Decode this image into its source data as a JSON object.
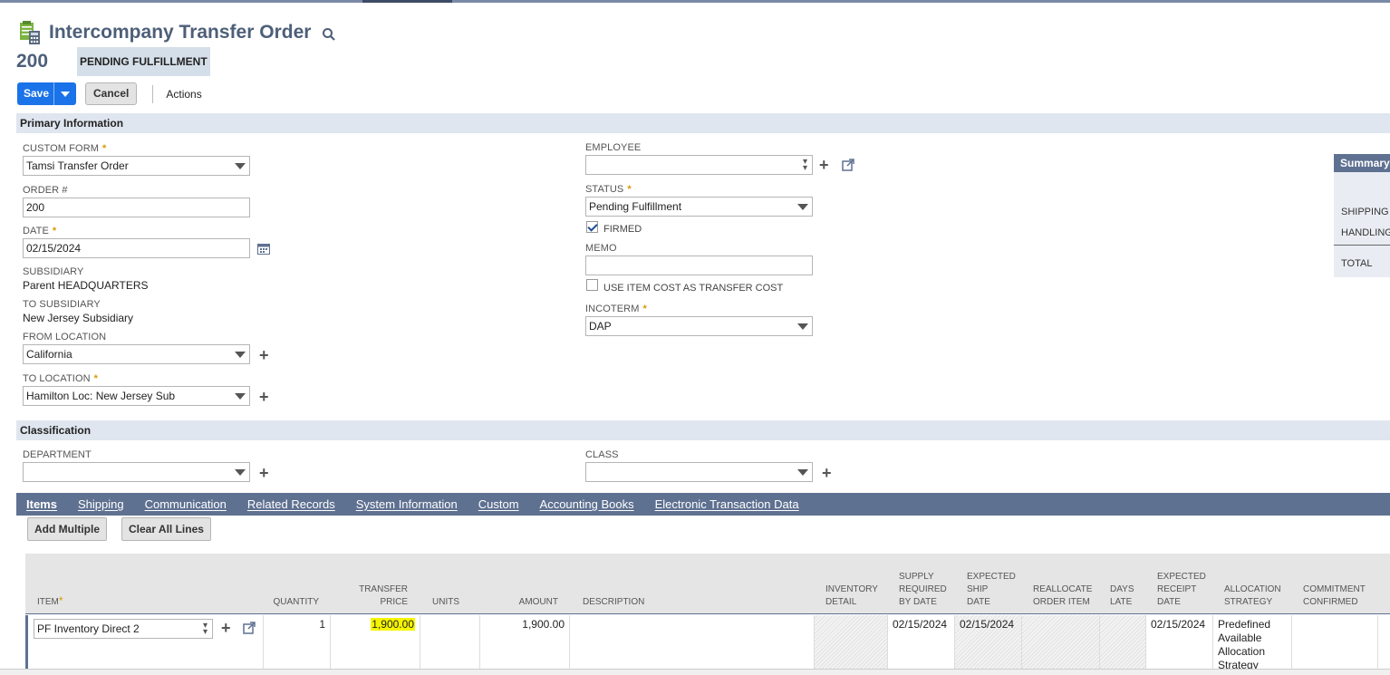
{
  "page": {
    "title": "Intercompany Transfer Order",
    "record_number": "200",
    "status_badge": "PENDING FULFILLMENT"
  },
  "buttons": {
    "save": "Save",
    "cancel": "Cancel",
    "actions": "Actions",
    "add_multiple": "Add Multiple",
    "clear_all_lines": "Clear All Lines"
  },
  "sections": {
    "primary": "Primary Information",
    "classification": "Classification"
  },
  "primary": {
    "custom_form": {
      "label": "CUSTOM FORM",
      "value": "Tamsi Transfer Order"
    },
    "order_no": {
      "label": "ORDER #",
      "value": "200"
    },
    "date": {
      "label": "DATE",
      "value": "02/15/2024"
    },
    "subsidiary": {
      "label": "SUBSIDIARY",
      "value": "Parent HEADQUARTERS"
    },
    "to_subsidiary": {
      "label": "TO SUBSIDIARY",
      "value": "New Jersey Subsidiary"
    },
    "from_location": {
      "label": "FROM LOCATION",
      "value": "California"
    },
    "to_location": {
      "label": "TO LOCATION",
      "value": "Hamilton Loc: New Jersey Sub"
    },
    "employee": {
      "label": "EMPLOYEE",
      "value": ""
    },
    "status": {
      "label": "STATUS",
      "value": "Pending Fulfillment"
    },
    "firmed": {
      "label": "FIRMED",
      "checked": true
    },
    "memo": {
      "label": "MEMO",
      "value": ""
    },
    "use_item_cost": {
      "label": "USE ITEM COST AS TRANSFER COST",
      "checked": false
    },
    "incoterm": {
      "label": "INCOTERM",
      "value": "DAP"
    }
  },
  "classification": {
    "department": {
      "label": "DEPARTMENT",
      "value": ""
    },
    "class": {
      "label": "CLASS",
      "value": ""
    }
  },
  "summary": {
    "title": "Summary",
    "shipping": "SHIPPING C",
    "handling": "HANDLING",
    "total": "TOTAL"
  },
  "tabs": [
    "Items",
    "Shipping",
    "Communication",
    "Related Records",
    "System Information",
    "Custom",
    "Accounting Books",
    "Electronic Transaction Data"
  ],
  "items_grid": {
    "headers": {
      "item": "ITEM",
      "quantity": "QUANTITY",
      "transfer_price": [
        "TRANSFER",
        "PRICE"
      ],
      "units": "UNITS",
      "amount": "AMOUNT",
      "description": "DESCRIPTION",
      "inventory_detail": [
        "INVENTORY",
        "DETAIL"
      ],
      "supply_required": [
        "SUPPLY",
        "REQUIRED",
        "BY DATE"
      ],
      "expected_ship": [
        "EXPECTED",
        "SHIP",
        "DATE"
      ],
      "reallocate": [
        "REALLOCATE",
        "ORDER ITEM"
      ],
      "days_late": [
        "DAYS",
        "LATE"
      ],
      "expected_receipt": [
        "EXPECTED",
        "RECEIPT",
        "DATE"
      ],
      "allocation_strategy": [
        "ALLOCATION",
        "STRATEGY"
      ],
      "commitment_confirmed": [
        "COMMITMENT",
        "CONFIRMED"
      ]
    },
    "row": {
      "item": "PF Inventory Direct 2",
      "quantity": "1",
      "transfer_price": "1,900.00",
      "units": "",
      "amount": "1,900.00",
      "description": "",
      "supply_required": "02/15/2024",
      "expected_ship": "02/15/2024",
      "expected_receipt": "02/15/2024",
      "allocation_strategy": [
        "Predefined",
        "Available",
        "Allocation",
        "Strategy"
      ]
    }
  },
  "colors": {
    "accent_blue": "#1a73e8",
    "tab_bar": "#5f7191",
    "section_bar": "#e0e6ef",
    "highlight": "#f5f500",
    "required_star": "#d99a00"
  }
}
